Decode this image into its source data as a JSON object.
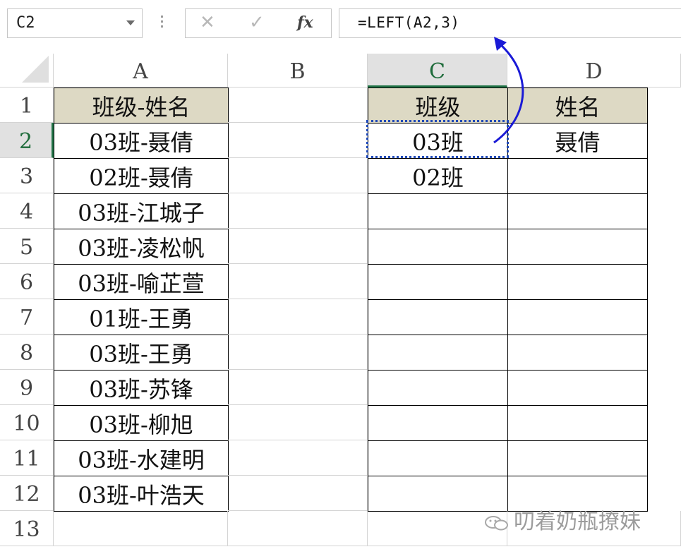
{
  "name_box": {
    "value": "C2"
  },
  "formula_bar": {
    "formula": "=LEFT(A2,3)",
    "cancel_icon": "✕",
    "enter_icon": "✓",
    "fx_label": "fx"
  },
  "columns": [
    "A",
    "B",
    "C",
    "D"
  ],
  "selected_column": "C",
  "rows": [
    "1",
    "2",
    "3",
    "4",
    "5",
    "6",
    "7",
    "8",
    "9",
    "10",
    "11",
    "12",
    "13"
  ],
  "selected_row": "2",
  "cells": {
    "A": [
      "班级-姓名",
      "03班-聂倩",
      "02班-聂倩",
      "03班-江城子",
      "03班-凌松帆",
      "03班-喻芷萱",
      "01班-王勇",
      "03班-王勇",
      "03班-苏锋",
      "03班-柳旭",
      "03班-水建明",
      "03班-叶浩天",
      ""
    ],
    "B": [
      "",
      "",
      "",
      "",
      "",
      "",
      "",
      "",
      "",
      "",
      "",
      "",
      ""
    ],
    "C": [
      "班级",
      "03班",
      "02班",
      "",
      "",
      "",
      "",
      "",
      "",
      "",
      "",
      "",
      ""
    ],
    "D": [
      "姓名",
      "聂倩",
      "",
      "",
      "",
      "",
      "",
      "",
      "",
      "",
      "",
      "",
      ""
    ]
  },
  "header_fill_color": "#ddd9c4",
  "selection_color": "#217346",
  "copy_marquee_color": "#1f49b8",
  "annotation_arrow_color": "#1a1ad6",
  "watermark": {
    "text": "叨着奶瓶撩妹",
    "icon": "wechat-icon"
  }
}
